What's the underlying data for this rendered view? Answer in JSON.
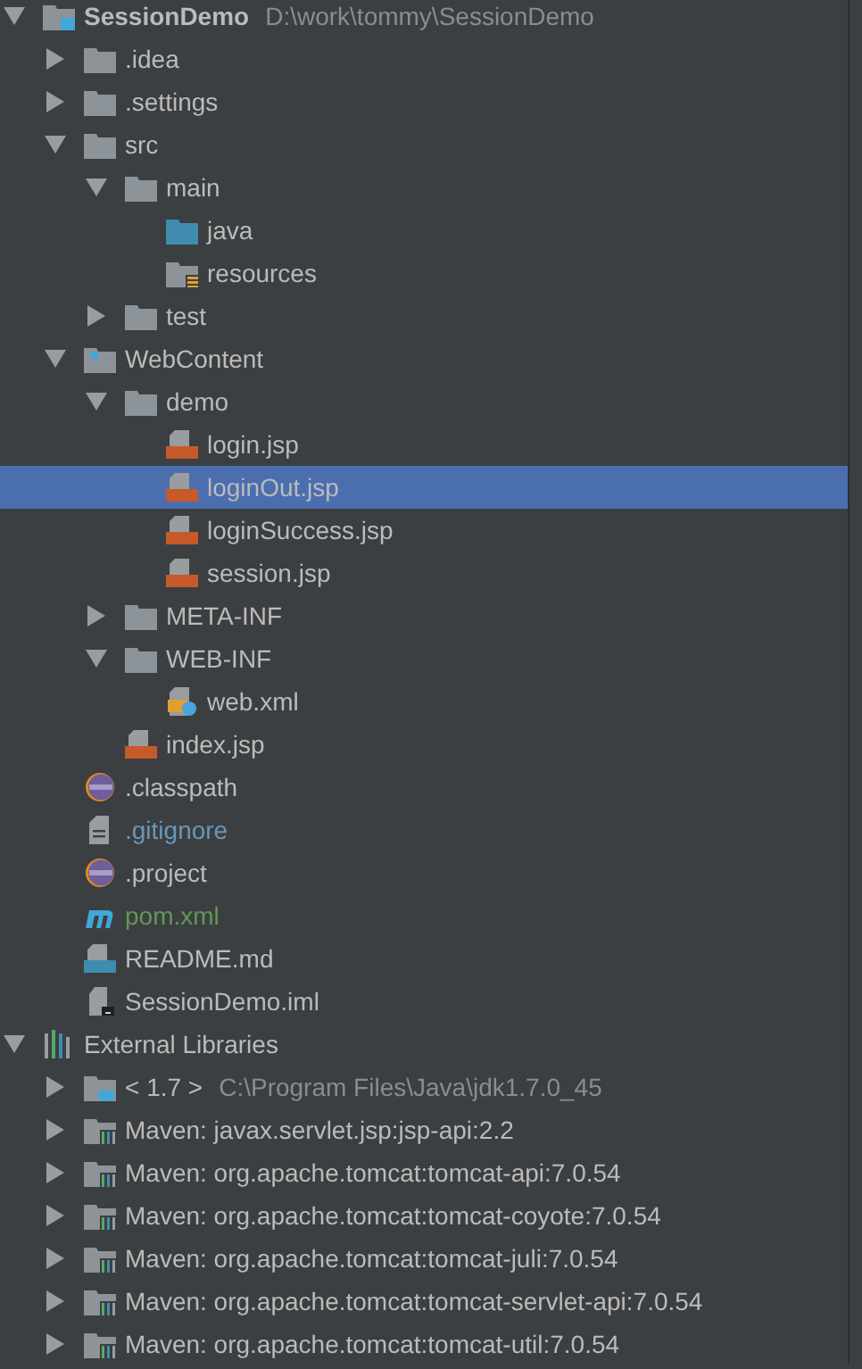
{
  "tree": [
    {
      "kind": "module",
      "label": "SessionDemo",
      "path": "D:\\work\\tommy\\SessionDemo",
      "expanded": true,
      "selected": false,
      "children": [
        {
          "kind": "folder",
          "label": ".idea",
          "expanded": false,
          "selected": false
        },
        {
          "kind": "folder",
          "label": ".settings",
          "expanded": false,
          "selected": false
        },
        {
          "kind": "folder",
          "label": "src",
          "expanded": true,
          "selected": false,
          "children": [
            {
              "kind": "folder",
              "label": "main",
              "expanded": true,
              "selected": false,
              "children": [
                {
                  "kind": "source-folder",
                  "label": "java",
                  "selected": false
                },
                {
                  "kind": "resource-folder",
                  "label": "resources",
                  "selected": false
                }
              ]
            },
            {
              "kind": "folder",
              "label": "test",
              "expanded": false,
              "selected": false
            }
          ]
        },
        {
          "kind": "web-folder",
          "label": "WebContent",
          "expanded": true,
          "selected": false,
          "children": [
            {
              "kind": "folder",
              "label": "demo",
              "expanded": true,
              "selected": false,
              "children": [
                {
                  "kind": "jsp",
                  "label": "login.jsp",
                  "selected": false
                },
                {
                  "kind": "jsp",
                  "label": "loginOut.jsp",
                  "selected": true
                },
                {
                  "kind": "jsp",
                  "label": "loginSuccess.jsp",
                  "selected": false
                },
                {
                  "kind": "jsp",
                  "label": "session.jsp",
                  "selected": false
                }
              ]
            },
            {
              "kind": "folder",
              "label": "META-INF",
              "expanded": false,
              "selected": false
            },
            {
              "kind": "folder",
              "label": "WEB-INF",
              "expanded": true,
              "selected": false,
              "children": [
                {
                  "kind": "xml",
                  "label": "web.xml",
                  "selected": false
                }
              ]
            },
            {
              "kind": "jsp",
              "label": "index.jsp",
              "selected": false
            }
          ]
        },
        {
          "kind": "eclipse",
          "label": ".classpath",
          "selected": false
        },
        {
          "kind": "text",
          "label": ".gitignore",
          "color": "#6897bb",
          "selected": false
        },
        {
          "kind": "eclipse",
          "label": ".project",
          "selected": false
        },
        {
          "kind": "maven",
          "label": "pom.xml",
          "color": "#629755",
          "selected": false
        },
        {
          "kind": "markdown",
          "label": "README.md",
          "selected": false
        },
        {
          "kind": "iml",
          "label": "SessionDemo.iml",
          "selected": false
        }
      ]
    },
    {
      "kind": "libraries",
      "label": "External Libraries",
      "expanded": true,
      "selected": false,
      "children": [
        {
          "kind": "jdk",
          "label": "< 1.7 >",
          "path": "C:\\Program Files\\Java\\jdk1.7.0_45",
          "expanded": false,
          "selected": false
        },
        {
          "kind": "library",
          "label": "Maven: javax.servlet.jsp:jsp-api:2.2",
          "expanded": false,
          "selected": false
        },
        {
          "kind": "library",
          "label": "Maven: org.apache.tomcat:tomcat-api:7.0.54",
          "expanded": false,
          "selected": false
        },
        {
          "kind": "library",
          "label": "Maven: org.apache.tomcat:tomcat-coyote:7.0.54",
          "expanded": false,
          "selected": false
        },
        {
          "kind": "library",
          "label": "Maven: org.apache.tomcat:tomcat-juli:7.0.54",
          "expanded": false,
          "selected": false
        },
        {
          "kind": "library",
          "label": "Maven: org.apache.tomcat:tomcat-servlet-api:7.0.54",
          "expanded": false,
          "selected": false
        },
        {
          "kind": "library",
          "label": "Maven: org.apache.tomcat:tomcat-util:7.0.54",
          "expanded": false,
          "selected": false
        }
      ]
    }
  ]
}
